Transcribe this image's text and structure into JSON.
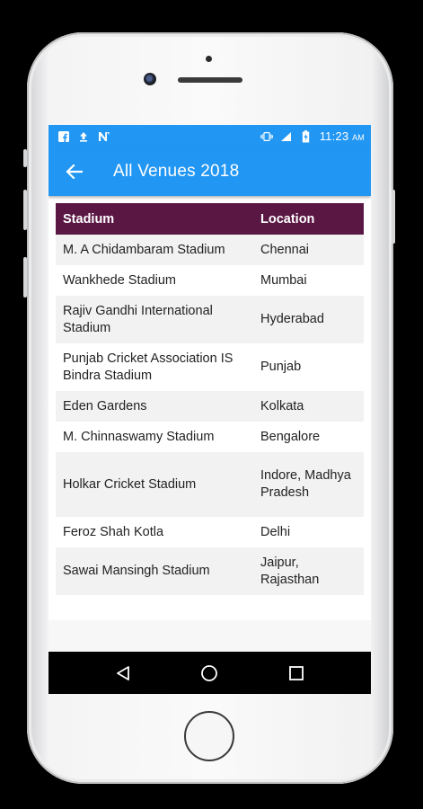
{
  "status_bar": {
    "time": "11:23",
    "ampm": "AM",
    "left_icons": [
      "facebook-icon",
      "upload-icon",
      "n-app-icon"
    ],
    "right_icons": [
      "vibrate-icon",
      "signal-icon",
      "battery-icon"
    ]
  },
  "app_bar": {
    "title": "All Venues 2018",
    "color": "#2196F3"
  },
  "table": {
    "header_color": "#5b1744",
    "headers": {
      "stadium": "Stadium",
      "location": "Location"
    },
    "rows": [
      {
        "stadium": "M. A Chidambaram Stadium",
        "location": "Chennai"
      },
      {
        "stadium": "Wankhede Stadium",
        "location": "Mumbai"
      },
      {
        "stadium": "Rajiv Gandhi International Stadium",
        "location": "Hyderabad"
      },
      {
        "stadium": "Punjab Cricket Association IS Bindra Stadium",
        "location": "Punjab"
      },
      {
        "stadium": "Eden Gardens",
        "location": "Kolkata"
      },
      {
        "stadium": "M. Chinnaswamy Stadium",
        "location": "Bengalore"
      },
      {
        "stadium": "Holkar Cricket Stadium",
        "location": "Indore, Madhya Pradesh"
      },
      {
        "stadium": "Feroz Shah Kotla",
        "location": "Delhi"
      },
      {
        "stadium": "Sawai Mansingh Stadium",
        "location": "Jaipur, Rajasthan"
      }
    ]
  },
  "nav_bar": {
    "buttons": [
      "back-triangle-icon",
      "home-circle-icon",
      "recents-square-icon"
    ]
  }
}
